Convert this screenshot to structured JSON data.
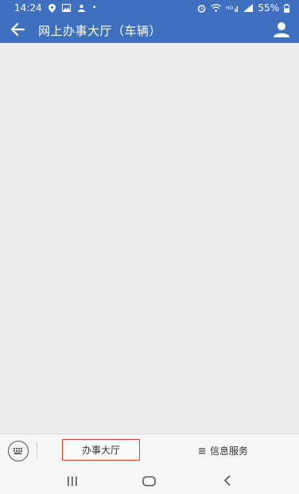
{
  "status_bar": {
    "time": "14:24",
    "battery": "55%",
    "icons_left": [
      "location-icon",
      "image-icon",
      "notification-icon",
      "dot-icon"
    ],
    "icons_right": [
      "alarm-icon",
      "wifi-icon",
      "hd-icon",
      "signal-icon",
      "battery-icon"
    ]
  },
  "app_bar": {
    "title": "网上办事大厅（车辆）",
    "back_icon": "arrow-left-icon",
    "profile_icon": "person-icon"
  },
  "bottom_bar": {
    "keyboard_icon": "keyboard-icon",
    "tab_hall": "办事大厅",
    "tab_info": "信息服务",
    "tab_info_icon": "menu-icon",
    "highlight_color": "#e03a2f"
  },
  "colors": {
    "primary": "#3f6fbf",
    "background": "#ececec"
  }
}
